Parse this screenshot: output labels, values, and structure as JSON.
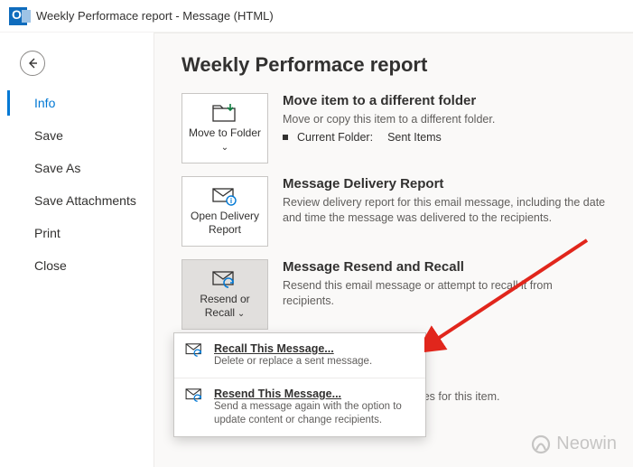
{
  "window": {
    "title": "Weekly Performace report  -  Message (HTML)"
  },
  "page_title": "Weekly Performace report",
  "sidebar": {
    "items": [
      {
        "label": "Info",
        "selected": true
      },
      {
        "label": "Save"
      },
      {
        "label": "Save As"
      },
      {
        "label": "Save Attachments"
      },
      {
        "label": "Print"
      },
      {
        "label": "Close"
      }
    ]
  },
  "sections": {
    "move": {
      "tile_label": "Move to Folder",
      "title": "Move item to a different folder",
      "desc": "Move or copy this item to a different folder.",
      "curfolder_label": "Current Folder:",
      "curfolder_value": "Sent Items"
    },
    "delivery": {
      "tile_label": "Open Delivery Report",
      "title": "Message Delivery Report",
      "desc": "Review delivery report for this email message, including the date and time the message was delivered to the recipients."
    },
    "resend": {
      "tile_label": "Resend or Recall",
      "title": "Message Resend and Recall",
      "desc": "Resend this email message or attempt to recall it from recipients."
    }
  },
  "popup": {
    "recall": {
      "title": "Recall This Message...",
      "desc": "Delete or replace a sent message."
    },
    "resend": {
      "title": "Resend This Message...",
      "desc": "Send a message again with the option to update content or change recipients."
    }
  },
  "props_trail": "and properties for this item.",
  "watermark": "Neowin"
}
